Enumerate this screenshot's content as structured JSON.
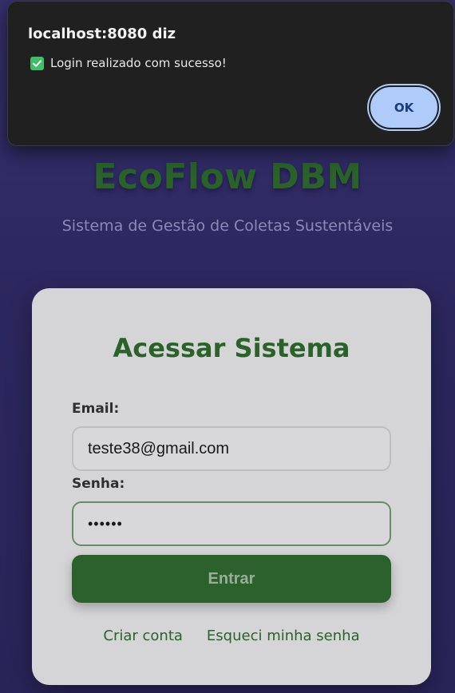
{
  "page": {
    "brand_title": "EcoFlow DBM",
    "brand_subtitle": "Sistema de Gestão de Coletas Sustentáveis"
  },
  "login_card": {
    "title": "Acessar Sistema",
    "email_label": "Email:",
    "email_value": "teste38@gmail.com",
    "password_label": "Senha:",
    "password_value": "••••••",
    "submit_label": "Entrar",
    "links": {
      "create_account": "Criar conta",
      "forgot_password": "Esqueci minha senha"
    }
  },
  "dialog": {
    "title": "localhost:8080 diz",
    "message": "Login realizado com sucesso!",
    "message_icon": "check-box-icon",
    "ok_label": "OK"
  },
  "colors": {
    "primary_green": "#2f6b30",
    "background_purple": "#3a3578",
    "dialog_background": "#202020",
    "ok_button": "#aecbfa"
  }
}
